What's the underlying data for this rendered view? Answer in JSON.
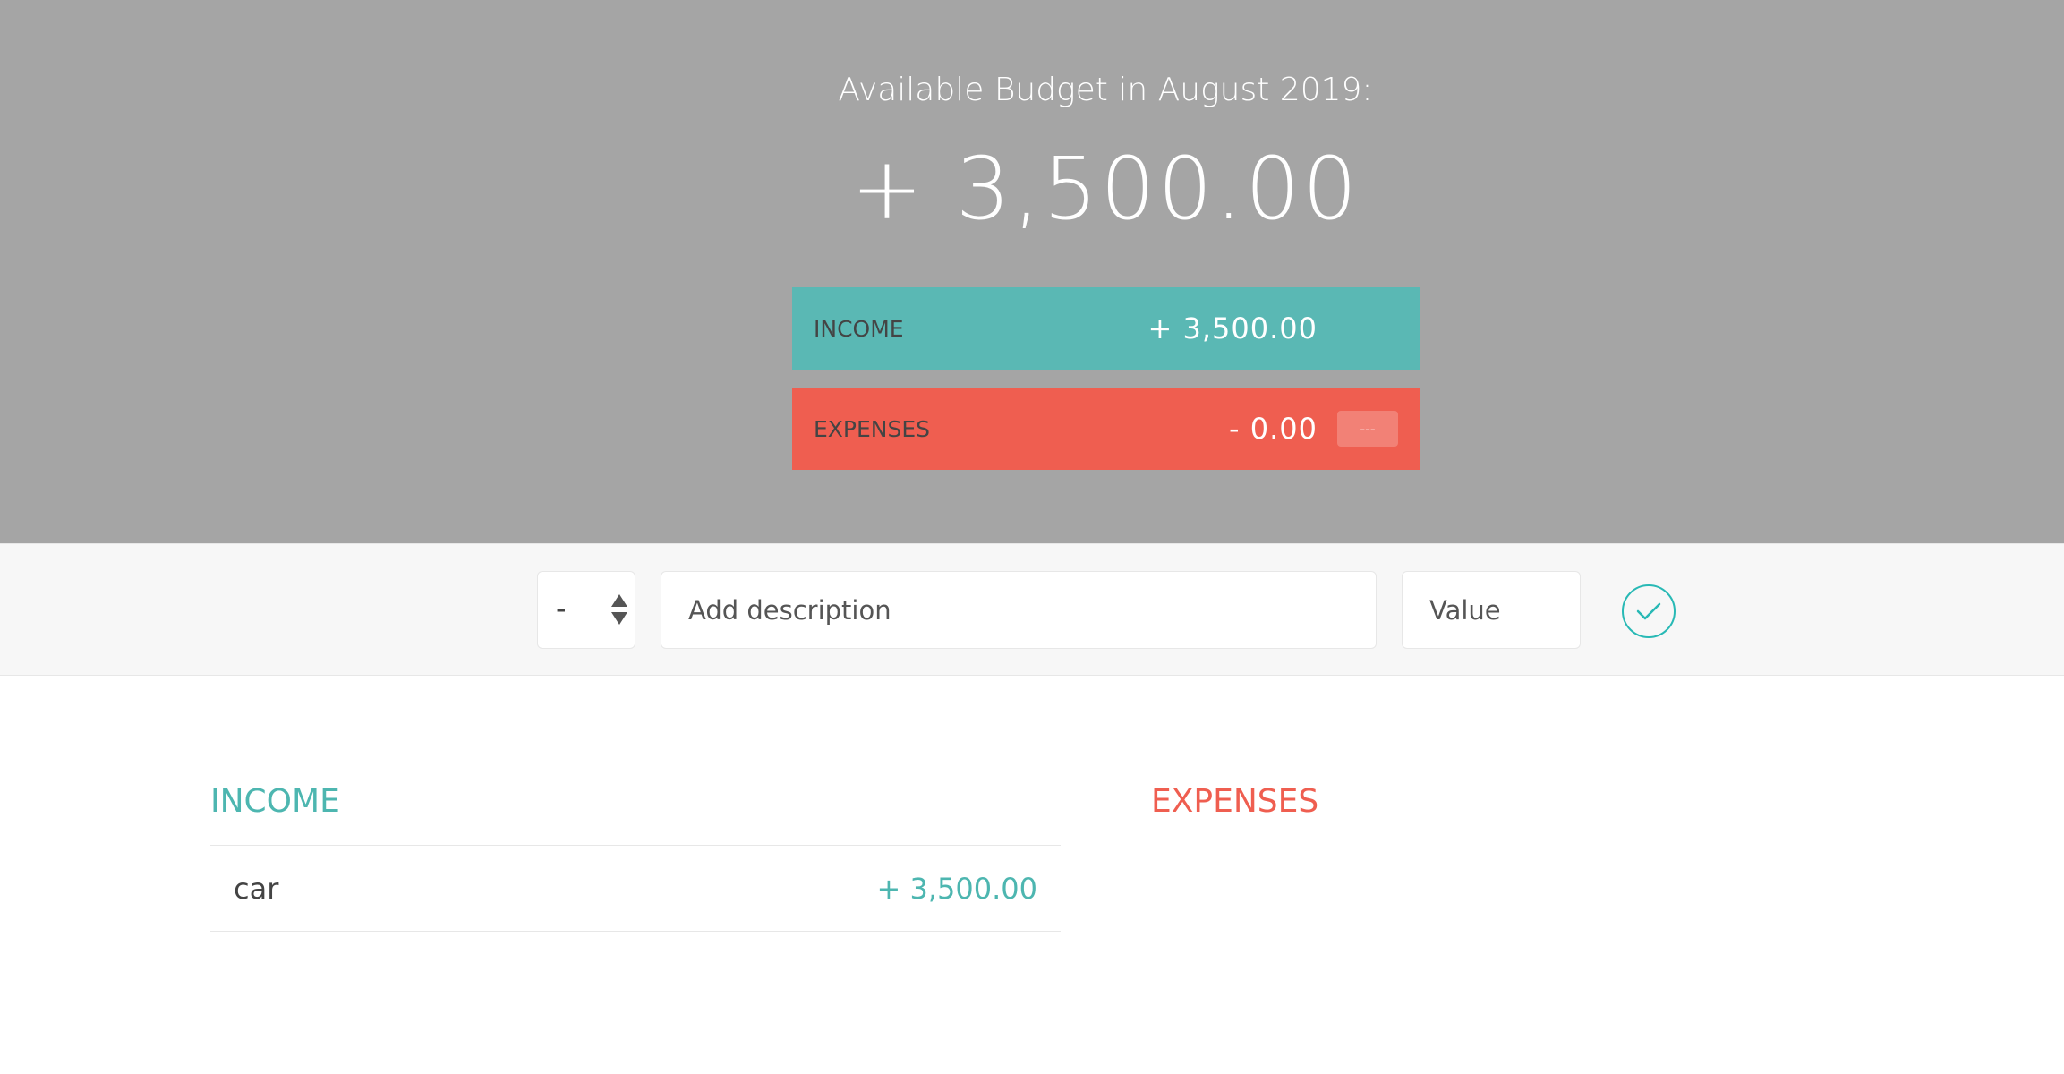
{
  "budget": {
    "title": "Available Budget in August 2019:",
    "value": "+ 3,500.00"
  },
  "summary": {
    "income": {
      "label": "INCOME",
      "value": "+ 3,500.00"
    },
    "expenses": {
      "label": "EXPENSES",
      "value": "- 0.00",
      "percentage": "---"
    }
  },
  "add": {
    "type_value": "-",
    "description_placeholder": "Add description",
    "value_placeholder": "Value",
    "submit_icon": "check-circle-icon"
  },
  "lists": {
    "income": {
      "title": "INCOME",
      "items": [
        {
          "description": "car",
          "value": "+ 3,500.00"
        }
      ]
    },
    "expenses": {
      "title": "EXPENSES",
      "items": []
    }
  },
  "colors": {
    "top_background": "#a5a5a5",
    "income": "#5ab8b4",
    "expenses": "#ef5e50",
    "accent": "#28b9b5"
  }
}
